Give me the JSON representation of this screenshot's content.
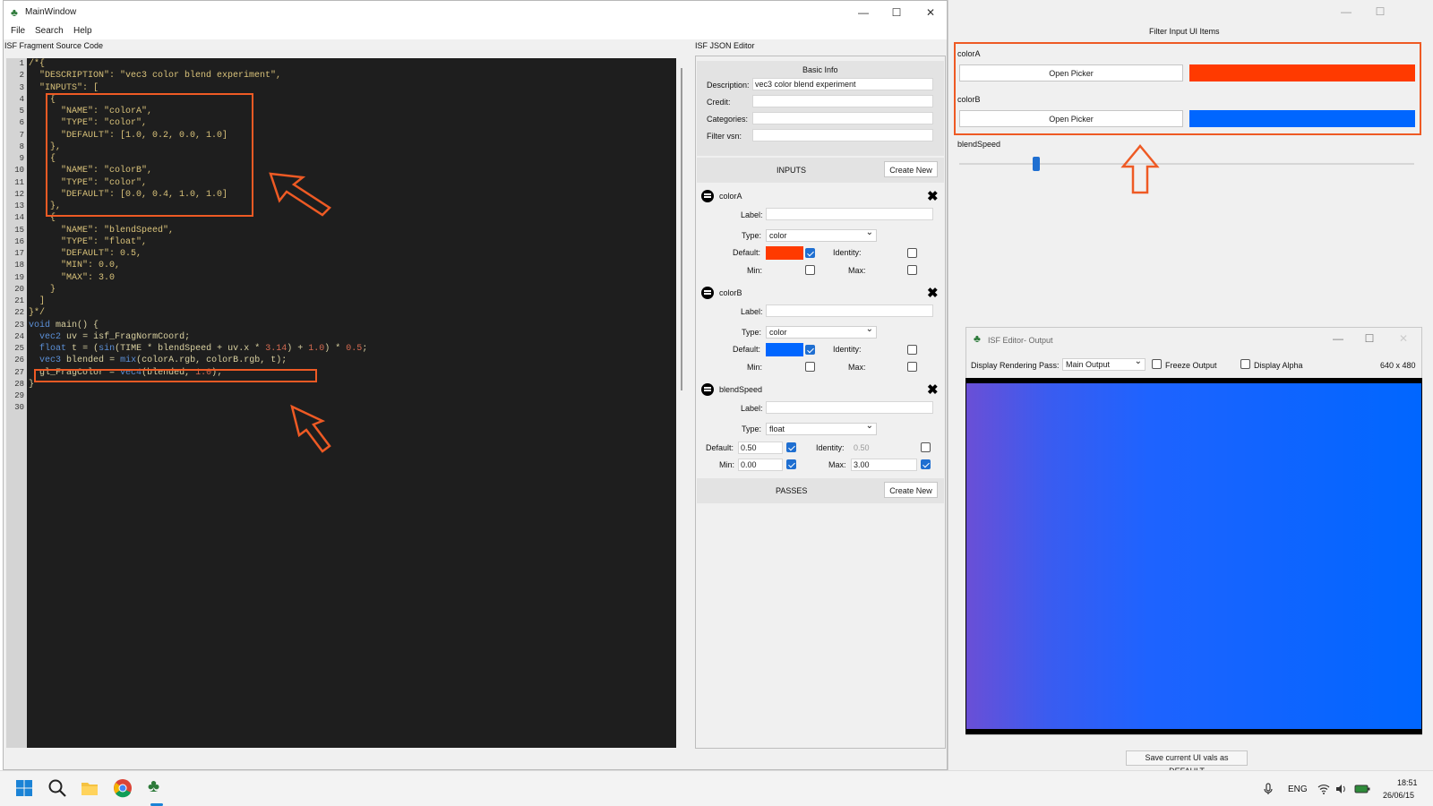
{
  "main_window": {
    "title": "MainWindow",
    "menu": [
      "File",
      "Search",
      "Help"
    ],
    "source_label": "ISF Fragment Source Code",
    "json_label": "ISF JSON Editor"
  },
  "code": {
    "line_numbers": "1\n2\n3\n4\n5\n6\n7\n8\n9\n10\n11\n12\n13\n14\n15\n16\n17\n18\n19\n20\n21\n22\n23\n24\n25\n26\n27\n28\n29\n30",
    "lines": [
      "/*{",
      "  \"DESCRIPTION\": \"vec3 color blend experiment\",",
      "  \"INPUTS\": [",
      "    {",
      "      \"NAME\": \"colorA\",",
      "      \"TYPE\": \"color\",",
      "      \"DEFAULT\": [1.0, 0.2, 0.0, 1.0]",
      "    },",
      "    {",
      "      \"NAME\": \"colorB\",",
      "      \"TYPE\": \"color\",",
      "      \"DEFAULT\": [0.0, 0.4, 1.0, 1.0]",
      "    },",
      "    {",
      "      \"NAME\": \"blendSpeed\",",
      "      \"TYPE\": \"float\",",
      "      \"DEFAULT\": 0.5,",
      "      \"MIN\": 0.0,",
      "      \"MAX\": 3.0",
      "    }",
      "  ]",
      "}*/",
      "",
      "void main() {",
      "  vec2 uv = isf_FragNormCoord;",
      "  float t = (sin(TIME * blendSpeed + uv.x * 3.14) + 1.0) * 0.5;",
      "  vec3 blended = mix(colorA.rgb, colorB.rgb, t);",
      "",
      "  gl_FragColor = vec4(blended, 1.0);",
      "}"
    ]
  },
  "json_editor": {
    "basic_info_title": "Basic Info",
    "description_label": "Description:",
    "description_value": "vec3 color blend experiment",
    "credit_label": "Credit:",
    "categories_label": "Categories:",
    "filter_vsn_label": "Filter vsn:",
    "inputs_title": "INPUTS",
    "create_new": "Create New",
    "passes_title": "PASSES",
    "label_label": "Label:",
    "type_label": "Type:",
    "default_label": "Default:",
    "identity_label": "Identity:",
    "min_label": "Min:",
    "max_label": "Max:",
    "inputs": [
      {
        "name": "colorA",
        "type": "color",
        "color": "#ff3a00"
      },
      {
        "name": "colorB",
        "type": "color",
        "color": "#0066ff"
      },
      {
        "name": "blendSpeed",
        "type": "float",
        "default": "0.50",
        "identity": "0.50",
        "min": "0.00",
        "max": "3.00"
      }
    ]
  },
  "filter_panel": {
    "title": "Filter Input UI Items",
    "colorA_label": "colorA",
    "colorB_label": "colorB",
    "open_picker": "Open Picker",
    "colorA": "#ff3a00",
    "colorB": "#0066ff",
    "blendSpeed_label": "blendSpeed",
    "slider_level": 0.17,
    "save_button": "Save current UI vals as DEFAULT"
  },
  "output_window": {
    "title": "ISF Editor- Output",
    "pass_label": "Display Rendering Pass:",
    "pass_value": "Main Output",
    "freeze_label": "Freeze Output",
    "alpha_label": "Display Alpha",
    "resolution": "640 x 480"
  },
  "taskbar": {
    "lang": "ENG",
    "time": "18:51",
    "date": "26/06/15"
  },
  "colors": {
    "accent": "#ee5a24",
    "check": "#1f6fd1"
  }
}
